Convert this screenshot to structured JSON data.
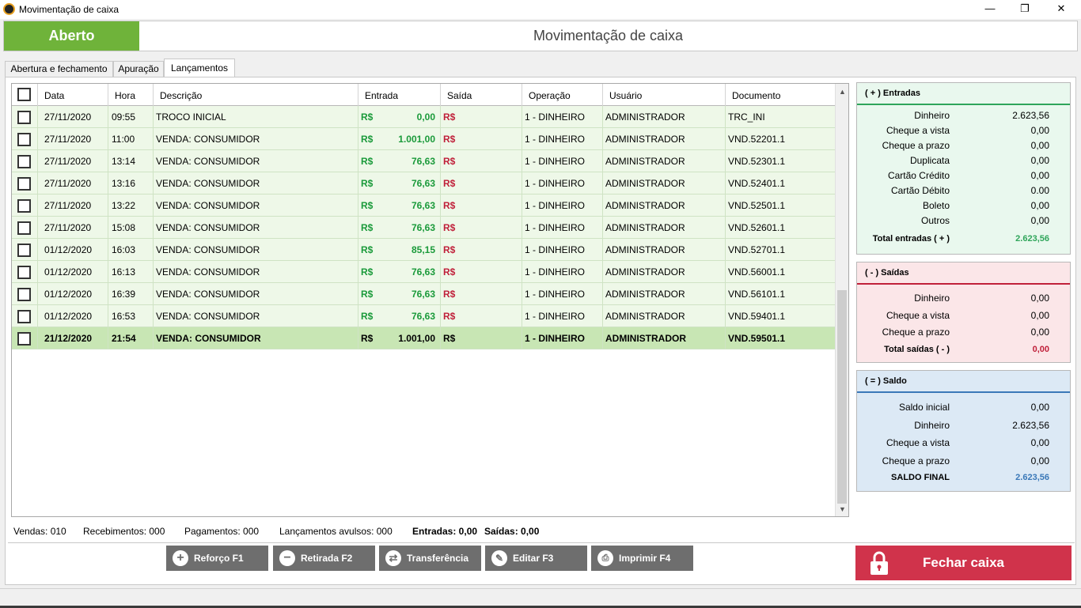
{
  "window": {
    "title": "Movimentação de caixa",
    "minimize": "—",
    "maximize": "❐",
    "close": "✕"
  },
  "header": {
    "status": "Aberto",
    "title": "Movimentação de caixa",
    "status_color": "#6fb33a"
  },
  "tabs": [
    {
      "label": "Abertura e fechamento"
    },
    {
      "label": "Apuração"
    },
    {
      "label": "Lançamentos",
      "active": true
    }
  ],
  "grid": {
    "columns": [
      "Data",
      "Hora",
      "Descrição",
      "Entrada",
      "Saída",
      "Operação",
      "Usuário",
      "Documento"
    ],
    "rows": [
      {
        "data": "27/11/2020",
        "hora": "09:55",
        "descricao": "TROCO INICIAL",
        "entrada_cur": "R$",
        "entrada": "0,00",
        "saida_cur": "R$",
        "operacao": "1 - DINHEIRO",
        "usuario": "ADMINISTRADOR",
        "documento": "TRC_INI"
      },
      {
        "data": "27/11/2020",
        "hora": "11:00",
        "descricao": "VENDA: CONSUMIDOR",
        "entrada_cur": "R$",
        "entrada": "1.001,00",
        "saida_cur": "R$",
        "operacao": "1 - DINHEIRO",
        "usuario": "ADMINISTRADOR",
        "documento": "VND.52201.1"
      },
      {
        "data": "27/11/2020",
        "hora": "13:14",
        "descricao": "VENDA: CONSUMIDOR",
        "entrada_cur": "R$",
        "entrada": "76,63",
        "saida_cur": "R$",
        "operacao": "1 - DINHEIRO",
        "usuario": "ADMINISTRADOR",
        "documento": "VND.52301.1"
      },
      {
        "data": "27/11/2020",
        "hora": "13:16",
        "descricao": "VENDA: CONSUMIDOR",
        "entrada_cur": "R$",
        "entrada": "76,63",
        "saida_cur": "R$",
        "operacao": "1 - DINHEIRO",
        "usuario": "ADMINISTRADOR",
        "documento": "VND.52401.1"
      },
      {
        "data": "27/11/2020",
        "hora": "13:22",
        "descricao": "VENDA: CONSUMIDOR",
        "entrada_cur": "R$",
        "entrada": "76,63",
        "saida_cur": "R$",
        "operacao": "1 - DINHEIRO",
        "usuario": "ADMINISTRADOR",
        "documento": "VND.52501.1"
      },
      {
        "data": "27/11/2020",
        "hora": "15:08",
        "descricao": "VENDA: CONSUMIDOR",
        "entrada_cur": "R$",
        "entrada": "76,63",
        "saida_cur": "R$",
        "operacao": "1 - DINHEIRO",
        "usuario": "ADMINISTRADOR",
        "documento": "VND.52601.1"
      },
      {
        "data": "01/12/2020",
        "hora": "16:03",
        "descricao": "VENDA: CONSUMIDOR",
        "entrada_cur": "R$",
        "entrada": "85,15",
        "saida_cur": "R$",
        "operacao": "1 - DINHEIRO",
        "usuario": "ADMINISTRADOR",
        "documento": "VND.52701.1"
      },
      {
        "data": "01/12/2020",
        "hora": "16:13",
        "descricao": "VENDA: CONSUMIDOR",
        "entrada_cur": "R$",
        "entrada": "76,63",
        "saida_cur": "R$",
        "operacao": "1 - DINHEIRO",
        "usuario": "ADMINISTRADOR",
        "documento": "VND.56001.1"
      },
      {
        "data": "01/12/2020",
        "hora": "16:39",
        "descricao": "VENDA: CONSUMIDOR",
        "entrada_cur": "R$",
        "entrada": "76,63",
        "saida_cur": "R$",
        "operacao": "1 - DINHEIRO",
        "usuario": "ADMINISTRADOR",
        "documento": "VND.56101.1"
      },
      {
        "data": "01/12/2020",
        "hora": "16:53",
        "descricao": "VENDA: CONSUMIDOR",
        "entrada_cur": "R$",
        "entrada": "76,63",
        "saida_cur": "R$",
        "operacao": "1 - DINHEIRO",
        "usuario": "ADMINISTRADOR",
        "documento": "VND.59401.1"
      },
      {
        "data": "21/12/2020",
        "hora": "21:54",
        "descricao": "VENDA: CONSUMIDOR",
        "entrada_cur": "R$",
        "entrada": "1.001,00",
        "saida_cur": "R$",
        "operacao": "1 - DINHEIRO",
        "usuario": "ADMINISTRADOR",
        "documento": "VND.59501.1",
        "selected": true
      }
    ]
  },
  "entradas": {
    "title": "( + ) Entradas",
    "items": [
      {
        "label": "Dinheiro",
        "value": "2.623,56"
      },
      {
        "label": "Cheque a vista",
        "value": "0,00"
      },
      {
        "label": "Cheque a prazo",
        "value": "0,00"
      },
      {
        "label": "Duplicata",
        "value": "0,00"
      },
      {
        "label": "Cartão Crédito",
        "value": "0,00"
      },
      {
        "label": "Cartão Débito",
        "value": "0.00"
      },
      {
        "label": "Boleto",
        "value": "0,00"
      },
      {
        "label": "Outros",
        "value": "0,00"
      }
    ],
    "total_label": "Total entradas ( + )",
    "total_value": "2.623,56",
    "bg": "#e9f8ee",
    "accent": "#2fa55a"
  },
  "saidas": {
    "title": "( - ) Saídas",
    "items": [
      {
        "label": "Dinheiro",
        "value": "0,00"
      },
      {
        "label": "Cheque a vista",
        "value": "0,00"
      },
      {
        "label": "Cheque a prazo",
        "value": "0,00"
      }
    ],
    "total_label": "Total saídas ( - )",
    "total_value": "0,00",
    "bg": "#fbe6e8",
    "accent": "#c0203a"
  },
  "saldo": {
    "title": "( = ) Saldo",
    "items": [
      {
        "label": "Saldo inicial",
        "value": "0,00"
      },
      {
        "label": "Dinheiro",
        "value": "2.623,56"
      },
      {
        "label": "Cheque a vista",
        "value": "0,00"
      },
      {
        "label": "Cheque a prazo",
        "value": "0,00"
      }
    ],
    "total_label": "SALDO FINAL",
    "total_value": "2.623,56",
    "bg": "#dce9f5",
    "accent": "#3a78b8"
  },
  "footer": {
    "vendas": "Vendas: 010",
    "recebimentos": "Recebimentos: 000",
    "pagamentos": "Pagamentos: 000",
    "avulsos": "Lançamentos avulsos: 000",
    "entradas": "Entradas: 0,00",
    "saidas": "Saídas: 0,00"
  },
  "buttons": {
    "reforco": "Reforço F1",
    "retirada": "Retirada F2",
    "transferencia": "Transferência",
    "editar": "Editar F3",
    "imprimir": "Imprimir F4",
    "fechar": "Fechar caixa"
  }
}
